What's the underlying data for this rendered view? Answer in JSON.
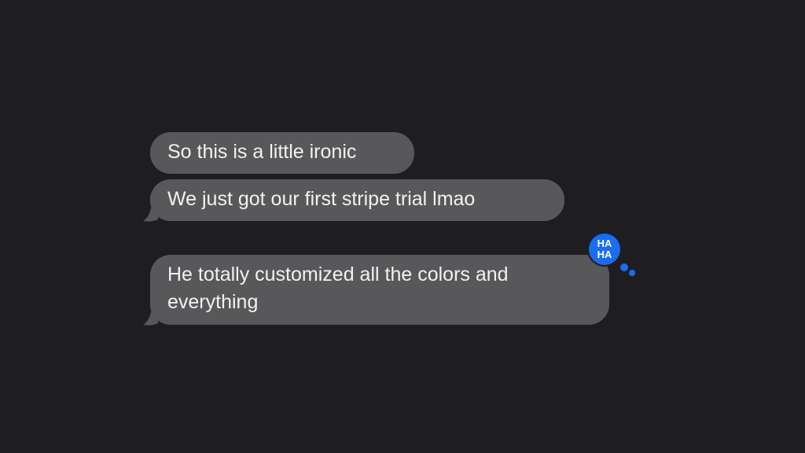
{
  "messages": [
    {
      "text": "So this is a little ironic",
      "tail": false,
      "tapback": null
    },
    {
      "text": "We just got our first stripe trial lmao",
      "tail": true,
      "tapback": null
    },
    {
      "text": "He totally customized all the colors and everything",
      "tail": true,
      "tapback": "haha"
    }
  ],
  "tapback": {
    "type": "haha",
    "icon": "haha-reaction-icon",
    "line1": "HA",
    "line2": "HA",
    "color": "#1a6cf0"
  },
  "colors": {
    "background": "#1e1e20",
    "bubble": "#58585a",
    "text": "#f2f2f2"
  }
}
